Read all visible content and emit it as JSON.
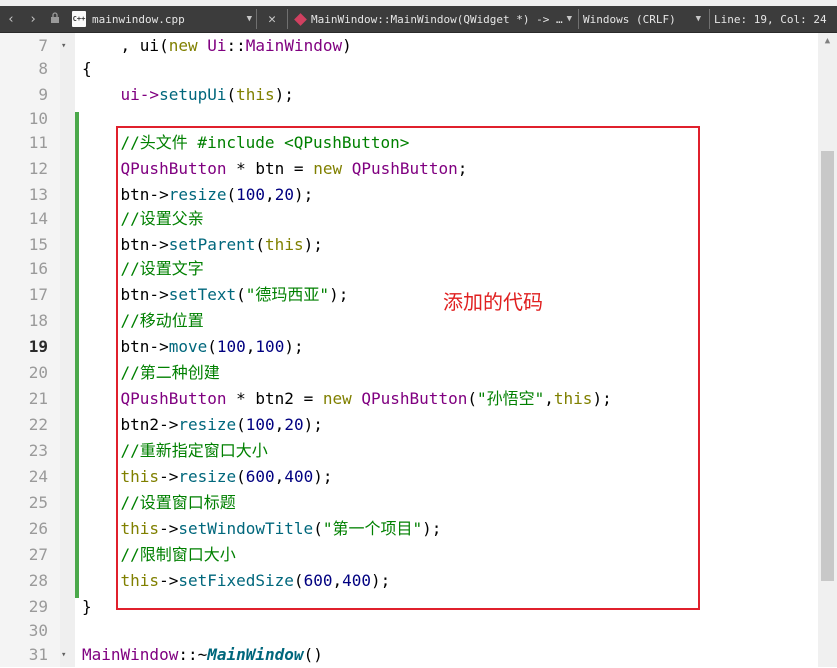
{
  "toolbar": {
    "back_icon": "‹",
    "forward_icon": "›",
    "file_icon_text": "C++",
    "file_name": "mainwindow.cpp",
    "close_icon": "✕",
    "symbol": "MainWindow::MainWindow(QWidget *) -> …",
    "line_endings": "Windows (CRLF)",
    "cursor_position": "Line: 19, Col: 24"
  },
  "annotation": "添加的代码",
  "lines": [
    {
      "num": "7",
      "fold": "▾",
      "tokens": [
        {
          "t": "    , ui(",
          "c": ""
        },
        {
          "t": "new",
          "c": "kw"
        },
        {
          "t": " ",
          "c": ""
        },
        {
          "t": "Ui",
          "c": "ty"
        },
        {
          "t": "::",
          "c": ""
        },
        {
          "t": "MainWindow",
          "c": "ty"
        },
        {
          "t": ")",
          "c": ""
        }
      ]
    },
    {
      "num": "8",
      "fold": "",
      "tokens": [
        {
          "t": "{",
          "c": ""
        }
      ]
    },
    {
      "num": "9",
      "fold": "",
      "tokens": [
        {
          "t": "    ui->",
          "c": "ty"
        },
        {
          "t": "setupUi",
          "c": "fn"
        },
        {
          "t": "(",
          "c": ""
        },
        {
          "t": "this",
          "c": "kw"
        },
        {
          "t": ");",
          "c": ""
        }
      ]
    },
    {
      "num": "10",
      "fold": "",
      "tokens": []
    },
    {
      "num": "11",
      "fold": "",
      "tokens": [
        {
          "t": "    //头文件 #include <QPushButton>",
          "c": "cm"
        }
      ]
    },
    {
      "num": "12",
      "fold": "",
      "tokens": [
        {
          "t": "    ",
          "c": ""
        },
        {
          "t": "QPushButton",
          "c": "ty"
        },
        {
          "t": " * btn = ",
          "c": ""
        },
        {
          "t": "new",
          "c": "kw"
        },
        {
          "t": " ",
          "c": ""
        },
        {
          "t": "QPushButton",
          "c": "ty"
        },
        {
          "t": ";",
          "c": ""
        }
      ]
    },
    {
      "num": "13",
      "fold": "",
      "tokens": [
        {
          "t": "    btn->",
          "c": ""
        },
        {
          "t": "resize",
          "c": "fn"
        },
        {
          "t": "(",
          "c": ""
        },
        {
          "t": "100",
          "c": "nu"
        },
        {
          "t": ",",
          "c": ""
        },
        {
          "t": "20",
          "c": "nu"
        },
        {
          "t": ");",
          "c": ""
        }
      ]
    },
    {
      "num": "14",
      "fold": "",
      "tokens": [
        {
          "t": "    //设置父亲",
          "c": "cm"
        }
      ]
    },
    {
      "num": "15",
      "fold": "",
      "tokens": [
        {
          "t": "    btn->",
          "c": ""
        },
        {
          "t": "setParent",
          "c": "fn"
        },
        {
          "t": "(",
          "c": ""
        },
        {
          "t": "this",
          "c": "kw"
        },
        {
          "t": ");",
          "c": ""
        }
      ]
    },
    {
      "num": "16",
      "fold": "",
      "tokens": [
        {
          "t": "    //设置文字",
          "c": "cm"
        }
      ]
    },
    {
      "num": "17",
      "fold": "",
      "tokens": [
        {
          "t": "    btn->",
          "c": ""
        },
        {
          "t": "setText",
          "c": "fn"
        },
        {
          "t": "(",
          "c": ""
        },
        {
          "t": "\"德玛西亚\"",
          "c": "st"
        },
        {
          "t": ");",
          "c": ""
        }
      ]
    },
    {
      "num": "18",
      "fold": "",
      "tokens": [
        {
          "t": "    //移动位置",
          "c": "cm"
        }
      ]
    },
    {
      "num": "19",
      "fold": "",
      "current": true,
      "tokens": [
        {
          "t": "    btn->",
          "c": ""
        },
        {
          "t": "move",
          "c": "fn"
        },
        {
          "t": "(",
          "c": ""
        },
        {
          "t": "100",
          "c": "nu"
        },
        {
          "t": ",",
          "c": ""
        },
        {
          "t": "100",
          "c": "nu"
        },
        {
          "t": ");",
          "c": ""
        }
      ]
    },
    {
      "num": "20",
      "fold": "",
      "tokens": [
        {
          "t": "    //第二种创建",
          "c": "cm"
        }
      ]
    },
    {
      "num": "21",
      "fold": "",
      "tokens": [
        {
          "t": "    ",
          "c": ""
        },
        {
          "t": "QPushButton",
          "c": "ty"
        },
        {
          "t": " * btn2 = ",
          "c": ""
        },
        {
          "t": "new",
          "c": "kw"
        },
        {
          "t": " ",
          "c": ""
        },
        {
          "t": "QPushButton",
          "c": "ty"
        },
        {
          "t": "(",
          "c": ""
        },
        {
          "t": "\"孙悟空\"",
          "c": "st"
        },
        {
          "t": ",",
          "c": ""
        },
        {
          "t": "this",
          "c": "kw"
        },
        {
          "t": ");",
          "c": ""
        }
      ]
    },
    {
      "num": "22",
      "fold": "",
      "tokens": [
        {
          "t": "    btn2->",
          "c": ""
        },
        {
          "t": "resize",
          "c": "fn"
        },
        {
          "t": "(",
          "c": ""
        },
        {
          "t": "100",
          "c": "nu"
        },
        {
          "t": ",",
          "c": ""
        },
        {
          "t": "20",
          "c": "nu"
        },
        {
          "t": ");",
          "c": ""
        }
      ]
    },
    {
      "num": "23",
      "fold": "",
      "tokens": [
        {
          "t": "    //重新指定窗口大小",
          "c": "cm"
        }
      ]
    },
    {
      "num": "24",
      "fold": "",
      "tokens": [
        {
          "t": "    ",
          "c": ""
        },
        {
          "t": "this",
          "c": "kw"
        },
        {
          "t": "->",
          "c": ""
        },
        {
          "t": "resize",
          "c": "fn"
        },
        {
          "t": "(",
          "c": ""
        },
        {
          "t": "600",
          "c": "nu"
        },
        {
          "t": ",",
          "c": ""
        },
        {
          "t": "400",
          "c": "nu"
        },
        {
          "t": ");",
          "c": ""
        }
      ]
    },
    {
      "num": "25",
      "fold": "",
      "tokens": [
        {
          "t": "    //设置窗口标题",
          "c": "cm"
        }
      ]
    },
    {
      "num": "26",
      "fold": "",
      "tokens": [
        {
          "t": "    ",
          "c": ""
        },
        {
          "t": "this",
          "c": "kw"
        },
        {
          "t": "->",
          "c": ""
        },
        {
          "t": "setWindowTitle",
          "c": "fn"
        },
        {
          "t": "(",
          "c": ""
        },
        {
          "t": "\"第一个项目\"",
          "c": "st"
        },
        {
          "t": ");",
          "c": ""
        }
      ]
    },
    {
      "num": "27",
      "fold": "",
      "tokens": [
        {
          "t": "    //限制窗口大小",
          "c": "cm"
        }
      ]
    },
    {
      "num": "28",
      "fold": "",
      "tokens": [
        {
          "t": "    ",
          "c": ""
        },
        {
          "t": "this",
          "c": "kw"
        },
        {
          "t": "->",
          "c": ""
        },
        {
          "t": "setFixedSize",
          "c": "fn"
        },
        {
          "t": "(",
          "c": ""
        },
        {
          "t": "600",
          "c": "nu"
        },
        {
          "t": ",",
          "c": ""
        },
        {
          "t": "400",
          "c": "nu"
        },
        {
          "t": ");",
          "c": ""
        }
      ]
    },
    {
      "num": "29",
      "fold": "",
      "tokens": [
        {
          "t": "}",
          "c": ""
        }
      ]
    },
    {
      "num": "30",
      "fold": "",
      "tokens": []
    },
    {
      "num": "31",
      "fold": "▾",
      "tokens": [
        {
          "t": "MainWindow",
          "c": "ty"
        },
        {
          "t": "::~",
          "c": ""
        },
        {
          "t": "MainWindow",
          "c": "dfn"
        },
        {
          "t": "()",
          "c": ""
        }
      ]
    }
  ]
}
